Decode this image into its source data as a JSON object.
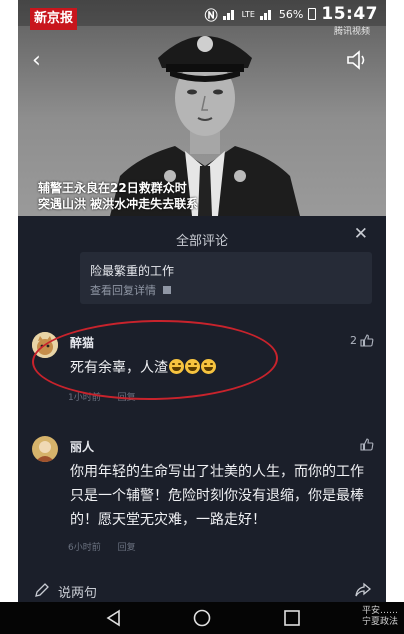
{
  "status_bar": {
    "logo_text": "新京报",
    "battery": "56%",
    "time": "15:47",
    "network": "LTE",
    "source_tag": "腾讯视频"
  },
  "video": {
    "caption_line1": "辅警王永良在22日救群众时",
    "caption_line2": "突遇山洪 被洪水冲走失去联系"
  },
  "comments_panel": {
    "title": "全部评论",
    "reply_preview": "险最繁重的工作",
    "reply_link": "查看回复详情",
    "comments": [
      {
        "name": "醉猫",
        "text": "死有余辜，人渣",
        "time": "1小时前",
        "reply": "回复",
        "likes": "2"
      },
      {
        "name": "丽人",
        "text": "你用年轻的生命写出了壮美的人生，而你的工作只是一个辅警！危险时刻你没有退缩，你是最棒的！愿天堂无灾难，一路走好！",
        "time": "6小时前",
        "reply": "回复",
        "likes": ""
      }
    ],
    "composer_placeholder": "说两句"
  },
  "watermark": {
    "line1": "平安……",
    "line2": "宁夏政法"
  },
  "colors": {
    "panel_bg": "#1b1f2a",
    "highlight_ring": "#c8232c",
    "logo_red": "#c8161d"
  },
  "icons": [
    "back-arrow-icon",
    "speaker-icon",
    "close-icon",
    "thumbs-up-icon",
    "pencil-icon",
    "share-icon",
    "nav-back-icon",
    "nav-home-icon",
    "nav-recents-icon"
  ]
}
